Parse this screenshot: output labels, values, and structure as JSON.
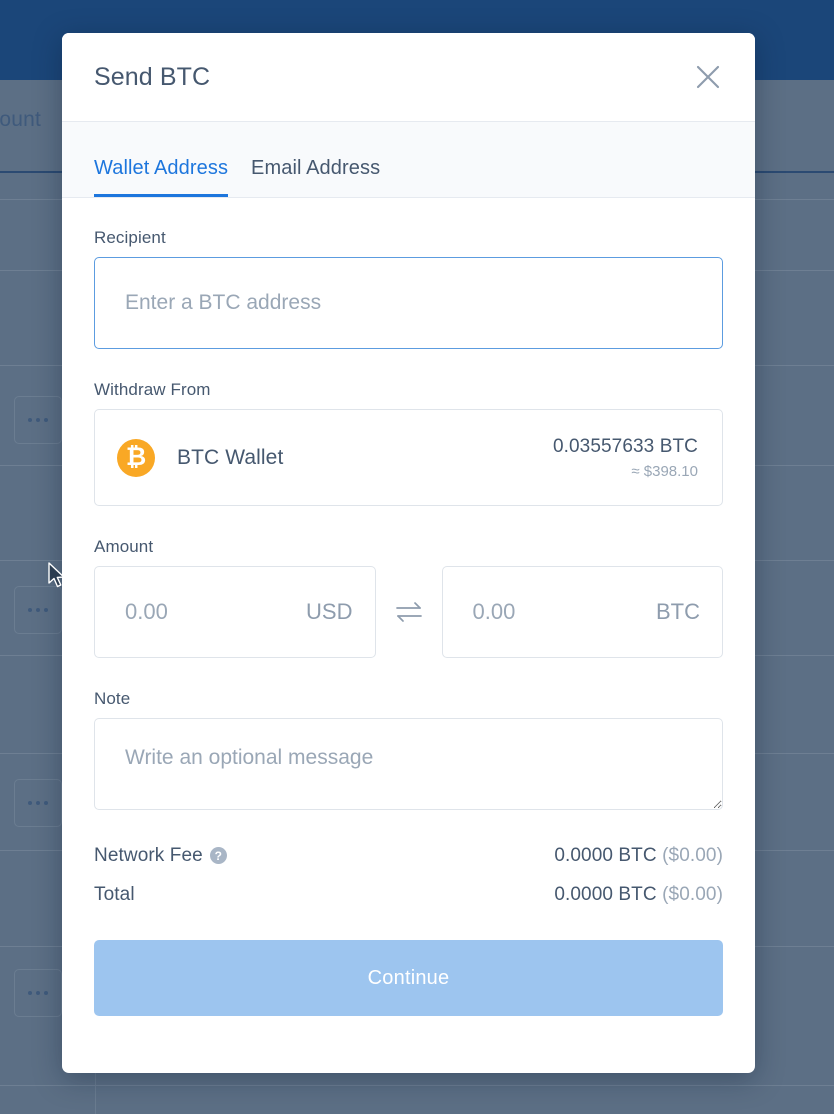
{
  "background": {
    "page_title": "ccount",
    "kebab_label": "•••"
  },
  "modal": {
    "title": "Send BTC",
    "close_icon": "close-icon",
    "tabs": [
      {
        "label": "Wallet Address",
        "active": true
      },
      {
        "label": "Email Address",
        "active": false
      }
    ],
    "recipient": {
      "label": "Recipient",
      "value": "",
      "placeholder": "Enter a BTC address"
    },
    "withdraw_from": {
      "label": "Withdraw From",
      "wallet_name": "BTC Wallet",
      "coin_icon": "bitcoin-icon",
      "coin_glyph": "₿",
      "balance": "0.03557633 BTC",
      "balance_fiat": "≈ $398.10"
    },
    "amount": {
      "label": "Amount",
      "fiat_value": "",
      "fiat_placeholder": "0.00",
      "fiat_currency": "USD",
      "swap_icon": "swap-arrows-icon",
      "crypto_value": "",
      "crypto_placeholder": "0.00",
      "crypto_currency": "BTC"
    },
    "note": {
      "label": "Note",
      "value": "",
      "placeholder": "Write an optional message"
    },
    "summary": [
      {
        "label": "Network Fee",
        "help": "?",
        "value": "0.0000 BTC ",
        "fiat": "($0.00)"
      },
      {
        "label": "Total",
        "help": "",
        "value": "0.0000 BTC ",
        "fiat": "($0.00)"
      }
    ],
    "continue_label": "Continue"
  },
  "colors": {
    "topbar": "#1b4679",
    "overlay": "#5c6f85",
    "accent": "#1d76dd",
    "bitcoin": "#f9a825",
    "button": "#9dc5ef",
    "text": "#46586f",
    "muted": "#9aa7b6"
  }
}
